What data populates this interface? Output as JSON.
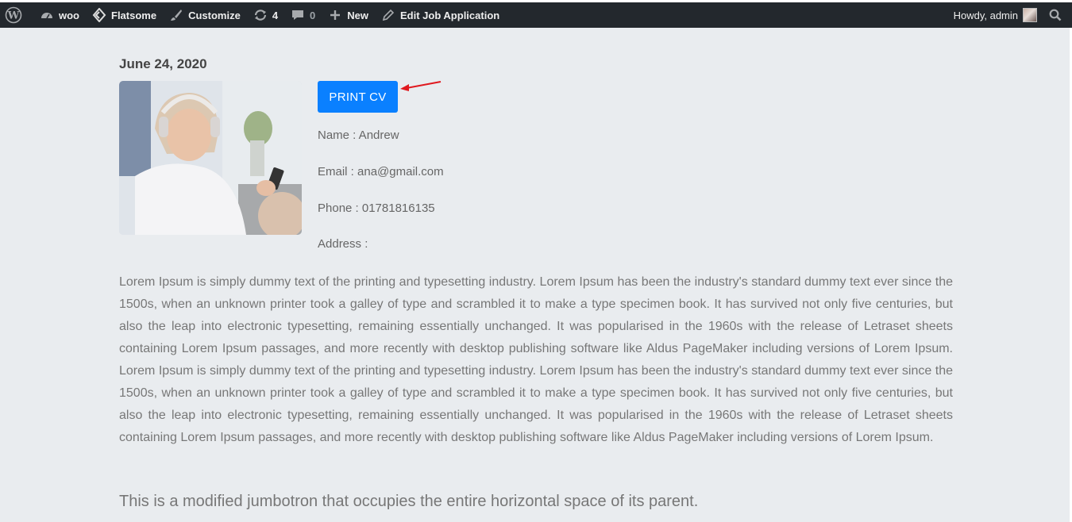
{
  "adminbar": {
    "wp_logo_icon": "wordpress-logo-icon",
    "site_name": "woo",
    "theme": "Flatsome",
    "customize": "Customize",
    "updates_count": "4",
    "comments_count": "0",
    "new_label": "New",
    "edit_label": "Edit Job Application",
    "howdy": "Howdy, admin"
  },
  "post": {
    "date": "June 24, 2020",
    "print_button": "PRINT CV",
    "name_line": "Name : Andrew",
    "email_line": "Email : ana@gmail.com",
    "phone_line": "Phone : 01781816135",
    "address_line": "Address :",
    "bio": "Lorem Ipsum is simply dummy text of the printing and typesetting industry. Lorem Ipsum has been the industry's standard dummy text ever since the 1500s, when an unknown printer took a galley of type and scrambled it to make a type specimen book. It has survived not only five centuries, but also the leap into electronic typesetting, remaining essentially unchanged. It was popularised in the 1960s with the release of Letraset sheets containing Lorem Ipsum passages, and more recently with desktop publishing software like Aldus PageMaker including versions of Lorem Ipsum. Lorem Ipsum is simply dummy text of the printing and typesetting industry. Lorem Ipsum has been the industry's standard dummy text ever since the 1500s, when an unknown printer took a galley of type and scrambled it to make a type specimen book. It has survived not only five centuries, but also the leap into electronic typesetting, remaining essentially unchanged. It was popularised in the 1960s with the release of Letraset sheets containing Lorem Ipsum passages, and more recently with desktop publishing software like Aldus PageMaker including versions of Lorem Ipsum.",
    "jumbotron_text": "This is a modified jumbotron that occupies the entire horizontal space of its parent."
  },
  "colors": {
    "adminbar_bg": "#23282d",
    "page_bg": "#e9ecef",
    "button_bg": "#0a80ff",
    "arrow": "#e0191f"
  }
}
